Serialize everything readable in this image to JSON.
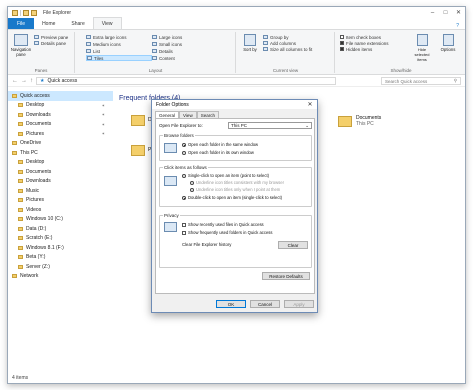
{
  "window": {
    "title": "File Explorer"
  },
  "ribbon_tabs": [
    "File",
    "Home",
    "Share",
    "View"
  ],
  "ribbon": {
    "panes": {
      "nav_pane": "Navigation pane",
      "preview": "Preview pane",
      "details": "Details pane",
      "group": "Panes"
    },
    "layout": {
      "items": [
        "Extra large icons",
        "Large icons",
        "Medium icons",
        "Small icons",
        "List",
        "Details",
        "Tiles",
        "Content"
      ],
      "group": "Layout"
    },
    "current_view": {
      "items": [
        "Group by",
        "Add columns",
        "Size all columns to fit"
      ],
      "sort": "Sort by",
      "group": "Current view"
    },
    "show_hide": {
      "item_checkboxes": "Item check boxes",
      "file_ext": "File name extensions",
      "hidden": "Hidden items",
      "hide_selected": "Hide selected items",
      "options": "Options",
      "group": "Show/hide"
    }
  },
  "address": {
    "path": "Quick access",
    "search_placeholder": "Search Quick access"
  },
  "nav": [
    {
      "label": "Quick access",
      "pinned": false
    },
    {
      "label": "Desktop",
      "pinned": true
    },
    {
      "label": "Downloads",
      "pinned": true
    },
    {
      "label": "Documents",
      "pinned": true
    },
    {
      "label": "Pictures",
      "pinned": true
    },
    {
      "label": "OneDrive",
      "pinned": false
    },
    {
      "label": "This PC",
      "pinned": false
    },
    {
      "label": "Desktop",
      "pinned": false
    },
    {
      "label": "Documents",
      "pinned": false
    },
    {
      "label": "Downloads",
      "pinned": false
    },
    {
      "label": "Music",
      "pinned": false
    },
    {
      "label": "Pictures",
      "pinned": false
    },
    {
      "label": "Videos",
      "pinned": false
    },
    {
      "label": "Windows 10 (C:)",
      "pinned": false
    },
    {
      "label": "Data (D:)",
      "pinned": false
    },
    {
      "label": "Scratch (E:)",
      "pinned": false
    },
    {
      "label": "Windows 8.1 (F:)",
      "pinned": false
    },
    {
      "label": "Beta (Y:)",
      "pinned": false
    },
    {
      "label": "Server (Z:)",
      "pinned": false
    },
    {
      "label": "Network",
      "pinned": false
    }
  ],
  "content": {
    "heading": "Frequent folders (4)",
    "folders": [
      {
        "name": "Documents",
        "sub": "This PC"
      },
      {
        "name": "De"
      },
      {
        "name": "Pi"
      }
    ],
    "status": "4 items"
  },
  "dialog": {
    "title": "Folder Options",
    "tabs": [
      "General",
      "View",
      "Search"
    ],
    "open_to_label": "Open File Explorer to:",
    "open_to_value": "This PC",
    "browse_group": "Browse folders",
    "browse_opts": [
      "Open each folder in the same window",
      "Open each folder in its own window"
    ],
    "click_group": "Click items as follows",
    "click_opts": [
      "Single-click to open an item (point to select)",
      "Underline icon titles consistent with my browser",
      "Underline icon titles only when I point at them",
      "Double-click to open an item (single-click to select)"
    ],
    "privacy_group": "Privacy",
    "privacy_opts": [
      "Show recently used files in Quick access",
      "Show frequently used folders in Quick access"
    ],
    "clear_label": "Clear File Explorer history",
    "clear_btn": "Clear",
    "restore_btn": "Restore Defaults",
    "ok": "OK",
    "cancel": "Cancel",
    "apply": "Apply"
  }
}
